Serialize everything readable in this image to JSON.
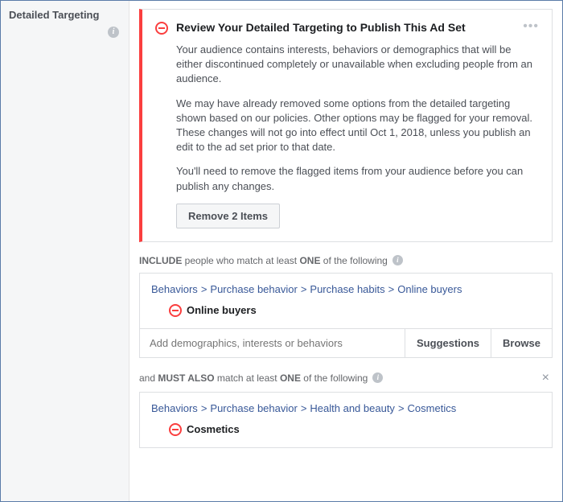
{
  "sidebar": {
    "title": "Detailed Targeting"
  },
  "alert": {
    "title": "Review Your Detailed Targeting to Publish This Ad Set",
    "para1": "Your audience contains interests, behaviors or demographics that will be either discontinued completely or unavailable when excluding people from an audience.",
    "para2": "We may have already removed some options from the detailed targeting shown based on our policies. Other options may be flagged for your removal. These changes will not go into effect until Oct 1, 2018, unless you publish an edit to the ad set prior to that date.",
    "para3": "You'll need to remove the flagged items from your audience before you can publish any changes.",
    "button": "Remove 2 Items"
  },
  "include": {
    "label_pre": "INCLUDE",
    "label_mid": " people who match at least ",
    "label_one": "ONE",
    "label_post": " of the following",
    "breadcrumb": {
      "a": "Behaviors",
      "b": "Purchase behavior",
      "c": "Purchase habits",
      "d": "Online buyers"
    },
    "flagged": "Online buyers",
    "input_placeholder": "Add demographics, interests or behaviors",
    "suggestions": "Suggestions",
    "browse": "Browse"
  },
  "also": {
    "label_pre": "and ",
    "label_must": "MUST ALSO",
    "label_mid": " match at least ",
    "label_one": "ONE",
    "label_post": " of the following",
    "breadcrumb": {
      "a": "Behaviors",
      "b": "Purchase behavior",
      "c": "Health and beauty",
      "d": "Cosmetics"
    },
    "flagged": "Cosmetics"
  }
}
